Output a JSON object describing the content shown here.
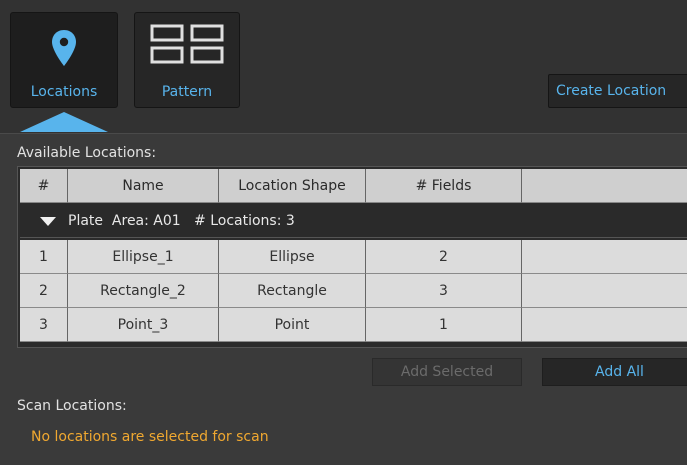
{
  "toolbar": {
    "locations_label": "Locations",
    "pattern_label": "Pattern",
    "create_location_label": "Create Location"
  },
  "colors": {
    "accent": "#58b4ec",
    "background": "#3a3a3a",
    "warning": "#f0a830"
  },
  "icons": {
    "locations": "map-pin-icon",
    "pattern": "grid-pattern-icon",
    "expand": "triangle-down-icon"
  },
  "available_label": "Available Locations:",
  "table": {
    "headers": [
      "#",
      "Name",
      "Location Shape",
      "# Fields",
      ""
    ],
    "group": {
      "text": "Plate  Area: A01   # Locations: 3"
    },
    "rows": [
      [
        "1",
        "Ellipse_1",
        "Ellipse",
        "2",
        ""
      ],
      [
        "2",
        "Rectangle_2",
        "Rectangle",
        "3",
        ""
      ],
      [
        "3",
        "Point_3",
        "Point",
        "1",
        ""
      ]
    ]
  },
  "buttons": {
    "add_selected": "Add Selected",
    "add_all": "Add All"
  },
  "scan_label": "Scan Locations:",
  "scan_empty_message": "No locations are selected for scan"
}
